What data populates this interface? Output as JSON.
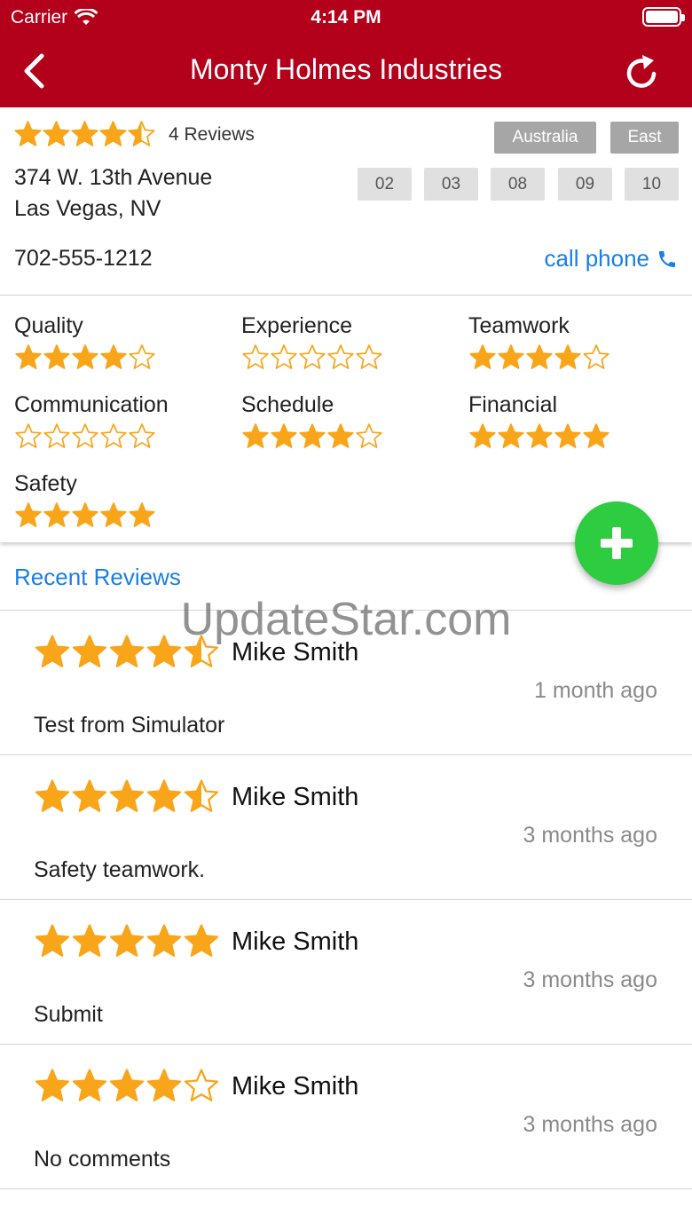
{
  "status_bar": {
    "carrier": "Carrier",
    "time": "4:14 PM"
  },
  "navbar": {
    "title": "Monty Holmes Industries",
    "back_icon": "chevron-left-icon",
    "refresh_icon": "refresh-icon"
  },
  "company": {
    "rating": 4.5,
    "reviews_label": "4 Reviews",
    "tags": [
      "Australia",
      "East"
    ],
    "address_line1": "374 W. 13th Avenue",
    "address_line2": "Las Vegas, NV",
    "numbers": [
      "02",
      "03",
      "08",
      "09",
      "10"
    ],
    "phone": "702-555-1212",
    "call_label": "call phone"
  },
  "categories": [
    {
      "label": "Quality",
      "rating": 4
    },
    {
      "label": "Experience",
      "rating": 0
    },
    {
      "label": "Teamwork",
      "rating": 4
    },
    {
      "label": "Communication",
      "rating": 0
    },
    {
      "label": "Schedule",
      "rating": 4
    },
    {
      "label": "Financial",
      "rating": 5
    },
    {
      "label": "Safety",
      "rating": 5
    }
  ],
  "recent": {
    "title": "Recent Reviews"
  },
  "watermark": "UpdateStar.com",
  "reviews": [
    {
      "rating": 4.5,
      "name": "Mike Smith",
      "ago": "1 month ago",
      "comment": "Test from Simulator"
    },
    {
      "rating": 4.5,
      "name": "Mike Smith",
      "ago": "3 months ago",
      "comment": "Safety teamwork."
    },
    {
      "rating": 5,
      "name": "Mike Smith",
      "ago": "3 months ago",
      "comment": "Submit"
    },
    {
      "rating": 4,
      "name": "Mike Smith",
      "ago": "3 months ago",
      "comment": "No comments"
    }
  ],
  "colors": {
    "header": "#b3001b",
    "star": "#f9a51a",
    "link": "#1a7ee6",
    "fab": "#2ecc40"
  }
}
